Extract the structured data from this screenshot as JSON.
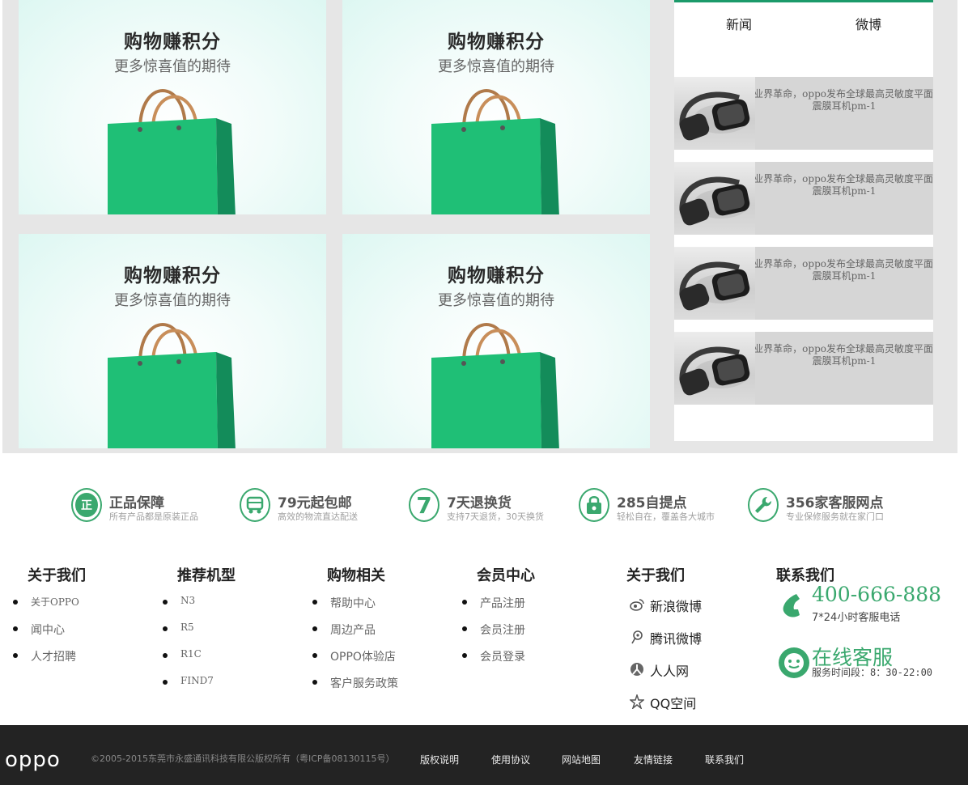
{
  "promos": [
    {
      "title": "购物赚积分",
      "subtitle": "更多惊喜值的期待"
    },
    {
      "title": "购物赚积分",
      "subtitle": "更多惊喜值的期待"
    },
    {
      "title": "购物赚积分",
      "subtitle": "更多惊喜值的期待"
    },
    {
      "title": "购物赚积分",
      "subtitle": "更多惊喜值的期待"
    }
  ],
  "news": {
    "tabs": [
      "新闻",
      "微博"
    ],
    "items": [
      {
        "line1": "业界革命，oppo发布全球最高灵敏度平面",
        "line2": "震膜耳机pm-1"
      },
      {
        "line1": "业界革命，oppo发布全球最高灵敏度平面",
        "line2": "震膜耳机pm-1"
      },
      {
        "line1": "业界革命，oppo发布全球最高灵敏度平面",
        "line2": "震膜耳机pm-1"
      },
      {
        "line1": "业界革命，oppo发布全球最高灵敏度平面",
        "line2": "震膜耳机pm-1"
      }
    ]
  },
  "services": [
    {
      "icon": "正",
      "title": "正品保障",
      "subtitle": "所有产品都是原装正品"
    },
    {
      "icon": "truck",
      "title": "79元起包邮",
      "subtitle": "高效的物流直达配送"
    },
    {
      "icon": "7",
      "title": "7天退换货",
      "subtitle": "支持7天退货，30天换货"
    },
    {
      "icon": "lock",
      "title": "285自提点",
      "subtitle": "轻松自在，覆盖各大城市"
    },
    {
      "icon": "wrench",
      "title": "356家客服网点",
      "subtitle": "专业保修服务就在家门口"
    }
  ],
  "footer": {
    "about": {
      "heading": "关于我们",
      "links": [
        "关于OPPO",
        "闻中心",
        "人才招聘"
      ]
    },
    "models": {
      "heading": "推荐机型",
      "links": [
        "N3",
        "R5",
        "R1C",
        "FIND7"
      ]
    },
    "shopping": {
      "heading": "购物相关",
      "links": [
        "帮助中心",
        "周边产品",
        "OPPO体验店",
        "客户服务政策"
      ]
    },
    "member": {
      "heading": "会员中心",
      "links": [
        "产品注册",
        "会员注册",
        "会员登录"
      ]
    },
    "social": {
      "heading": "关于我们",
      "links": [
        "新浪微博",
        "腾讯微博",
        "人人网",
        "QQ空间"
      ]
    },
    "contact": {
      "heading": "联系我们",
      "phone": "400-666-888",
      "phone_note": "7*24小时客服电话",
      "chat": "在线客服",
      "chat_hours": "服务时间段：8：30-22:00"
    }
  },
  "bottom": {
    "logo": "oppo",
    "copyright": "©2005-2015东莞市永盛通讯科技有限公版权所有（粤ICP备08130115号）",
    "links": [
      "版权说明",
      "使用协议",
      "网站地图",
      "友情链接",
      "联系我们"
    ]
  },
  "colors": {
    "accent": "#3aa86e",
    "bag": "#1fbf76",
    "bottom_bar": "#232323"
  }
}
